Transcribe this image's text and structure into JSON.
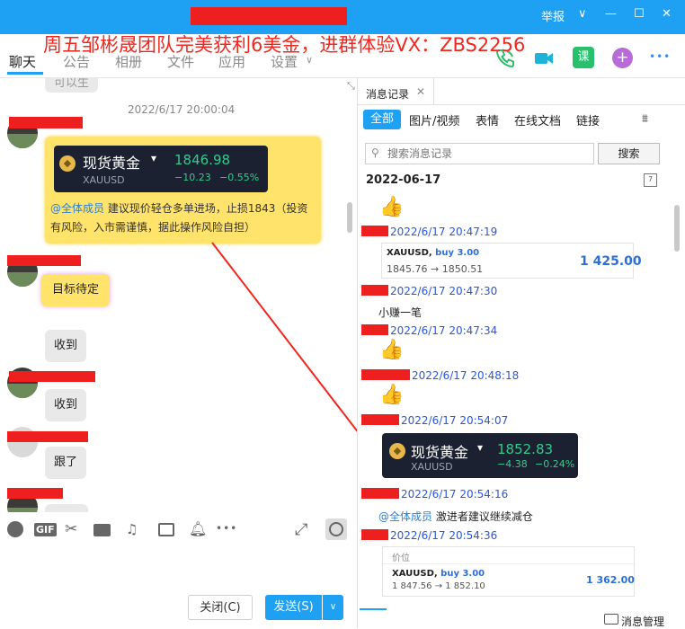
{
  "titlebar": {
    "report": "举报",
    "chevron": "∨",
    "minimize": "—",
    "maximize": "☐",
    "close": "✕"
  },
  "promo_text": "周五邹彬晟团队完美获利6美金，进群体验VX：ZBS2256",
  "tabs": [
    "聊天",
    "公告",
    "相册",
    "文件",
    "应用",
    "设置"
  ],
  "header_icons": {
    "call": "call-icon",
    "video": "video-icon",
    "course": "课",
    "add": "+",
    "more": "•••"
  },
  "chat": {
    "top_bubble": "可以生",
    "timestamp": "2022/6/17 20:00:04",
    "ticker1": {
      "name": "现货黄金",
      "dropdown": "▾",
      "symbol": "XAUUSD",
      "price": "1846.98",
      "change": "−10.23",
      "change_pct": "−0.55%"
    },
    "announcement": {
      "mention": "@全体成员",
      "text": " 建议现价轻仓多单进场，止损1843（投资有风险，入市需谨慎，据此操作风险自担）"
    },
    "msg_target": "目标待定",
    "msg_received1": "收到",
    "msg_received2": "收到",
    "msg_followed": "跟了"
  },
  "toolbar": {
    "close_label": "关闭(C)",
    "send_label": "发送(S)",
    "send_dropdown": "∨"
  },
  "history": {
    "title": "消息记录",
    "close": "✕",
    "filters": [
      "全部",
      "图片/视频",
      "表情",
      "在线文档",
      "链接"
    ],
    "search_placeholder": "搜索消息记录",
    "search_button": "搜索",
    "date": "2022-06-17",
    "records": [
      {
        "time": "2022/6/17 20:47:19"
      },
      {
        "time": "2022/6/17 20:47:30"
      },
      {
        "time": "2022/6/17 20:47:34"
      },
      {
        "time": "2022/6/17 20:48:18"
      },
      {
        "time": "2022/6/17 20:54:07"
      },
      {
        "time": "2022/6/17 20:54:16"
      },
      {
        "time": "2022/6/17 20:54:36"
      }
    ],
    "trade1": {
      "symbol": "XAUUSD,",
      "side": " buy 3.00",
      "range": "1845.76 → 1850.51",
      "profit": "1 425.00"
    },
    "text_msg": "小赚一笔",
    "ticker2": {
      "name": "现货黄金",
      "dropdown": "▾",
      "symbol": "XAUUSD",
      "price": "1852.83",
      "change": "−4.38",
      "change_pct": "−0.24%"
    },
    "announcement2": {
      "mention": "@全体成员",
      "text": " 激进者建议继续减仓"
    },
    "trade2": {
      "label": "价位",
      "symbol": "XAUUSD,",
      "side": " buy 3.00",
      "range": "1 847.56 → 1 852.10",
      "profit": "1 362.00"
    },
    "manage": "消息管理"
  },
  "colors": {
    "accent": "#1ea0f3",
    "redact": "#ee1f1f",
    "promo": "#f0271e",
    "gain": "#37c98c",
    "bubble_yellow": "#ffe36a"
  }
}
